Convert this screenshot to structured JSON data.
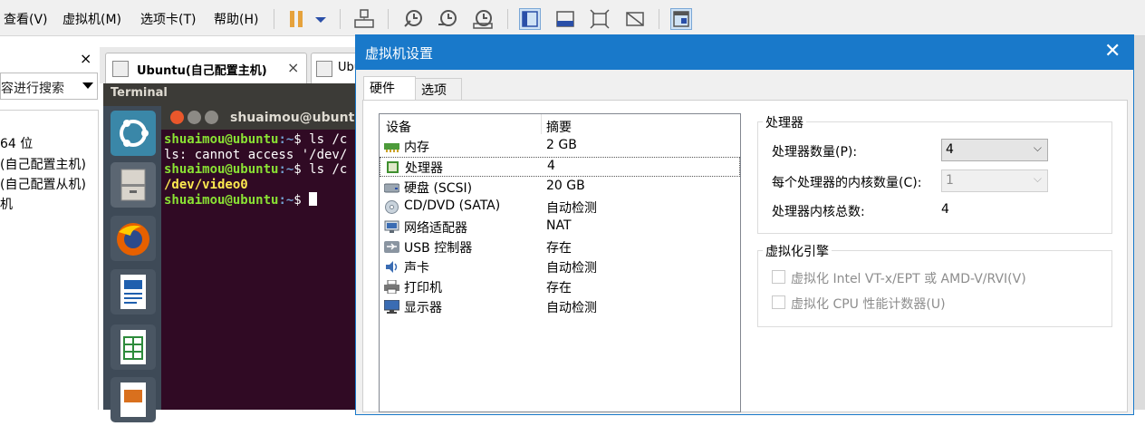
{
  "menubar": {
    "items": [
      "查看(V)",
      "虚拟机(M)",
      "选项卡(T)",
      "帮助(H)"
    ]
  },
  "library": {
    "close_glyph": "×",
    "search_placeholder": "容进行搜索",
    "items": [
      "64 位",
      "(自己配置主机)",
      "(自己配置从机)",
      "机"
    ]
  },
  "vm_tabs": [
    {
      "label": "Ubuntu(自己配置主机)",
      "close": "×"
    },
    {
      "label": "Ubu"
    }
  ],
  "ubuntu": {
    "panel_title": "Terminal",
    "terminal_title": "shuaimou@ubuntu:",
    "prompt_user": "shuaimou@ubuntu",
    "prompt_path": ":~",
    "prompt_end": "$ ",
    "cmd1": "ls /c",
    "output1": "ls: cannot access '/dev/",
    "cmd2": "ls /c",
    "output2": "/dev/video0"
  },
  "dialog": {
    "title": "虚拟机设置",
    "close_glyph": "✕",
    "tabs": [
      "硬件",
      "选项"
    ],
    "device_header": "设备",
    "summary_header": "摘要",
    "devices": [
      {
        "name": "内存",
        "summary": "2 GB",
        "icon": "memory-icon"
      },
      {
        "name": "处理器",
        "summary": "4",
        "icon": "processor-icon"
      },
      {
        "name": "硬盘 (SCSI)",
        "summary": "20 GB",
        "icon": "hard-disk-icon"
      },
      {
        "name": "CD/DVD (SATA)",
        "summary": "自动检测",
        "icon": "cd-dvd-icon"
      },
      {
        "name": "网络适配器",
        "summary": "NAT",
        "icon": "network-adapter-icon"
      },
      {
        "name": "USB 控制器",
        "summary": "存在",
        "icon": "usb-icon"
      },
      {
        "name": "声卡",
        "summary": "自动检测",
        "icon": "sound-card-icon"
      },
      {
        "name": "打印机",
        "summary": "存在",
        "icon": "printer-icon"
      },
      {
        "name": "显示器",
        "summary": "自动检测",
        "icon": "display-icon"
      }
    ],
    "processor_group": {
      "title": "处理器",
      "count_label": "处理器数量(P):",
      "count_value": "4",
      "cores_label": "每个处理器的内核数量(C):",
      "cores_value": "1",
      "total_label": "处理器内核总数:",
      "total_value": "4"
    },
    "virt_group": {
      "title": "虚拟化引擎",
      "option1": "虚拟化 Intel VT-x/EPT 或 AMD-V/RVI(V)",
      "option2": "虚拟化 CPU 性能计数器(U)"
    },
    "combo_arrow": "⌵"
  }
}
